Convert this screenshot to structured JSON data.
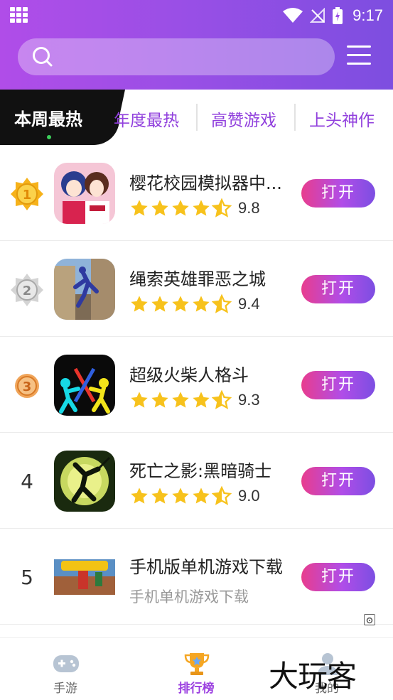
{
  "status_bar": {
    "time": "9:17"
  },
  "search": {
    "placeholder": ""
  },
  "tabs": {
    "active": "本周最热",
    "others": [
      "年度最热",
      "高赞游戏",
      "上头神作"
    ]
  },
  "games": [
    {
      "rank": "1",
      "name": "樱花校园模拟器中...",
      "rating": "9.8",
      "stars": 4.5,
      "button": "打开"
    },
    {
      "rank": "2",
      "name": "绳索英雄罪恶之城",
      "rating": "9.4",
      "stars": 4.5,
      "button": "打开"
    },
    {
      "rank": "3",
      "name": "超级火柴人格斗",
      "rating": "9.3",
      "stars": 4.5,
      "button": "打开"
    },
    {
      "rank": "4",
      "name": "死亡之影:黑暗骑士",
      "rating": "9.0",
      "stars": 4.5,
      "button": "打开"
    },
    {
      "rank": "5",
      "name": "手机版单机游戏下载",
      "subtitle": "手机单机游戏下载",
      "button": "打开"
    }
  ],
  "bottom_nav": {
    "items": [
      {
        "label": "手游",
        "icon": "gamepad-icon",
        "active": false
      },
      {
        "label": "排行榜",
        "icon": "trophy-icon",
        "active": true
      },
      {
        "label": "我的",
        "icon": "profile-icon",
        "active": false
      }
    ]
  },
  "watermark": "大玩客",
  "colors": {
    "header_start": "#b04de8",
    "header_end": "#7d4ee0",
    "accent": "#9140dd",
    "button_start": "#e83d8e",
    "star": "#f7c21c"
  }
}
